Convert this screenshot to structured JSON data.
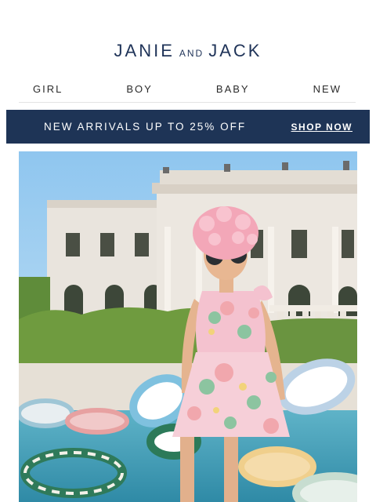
{
  "brand": {
    "part1": "JANIE",
    "part2": "AND",
    "part3": "JACK"
  },
  "nav": {
    "items": [
      "GIRL",
      "BOY",
      "BABY",
      "NEW"
    ]
  },
  "promo": {
    "message": "NEW ARRIVALS UP TO 25% OFF",
    "cta": "SHOP NOW"
  },
  "colors": {
    "navy": "#1e3456",
    "brand_text": "#1f3358"
  }
}
